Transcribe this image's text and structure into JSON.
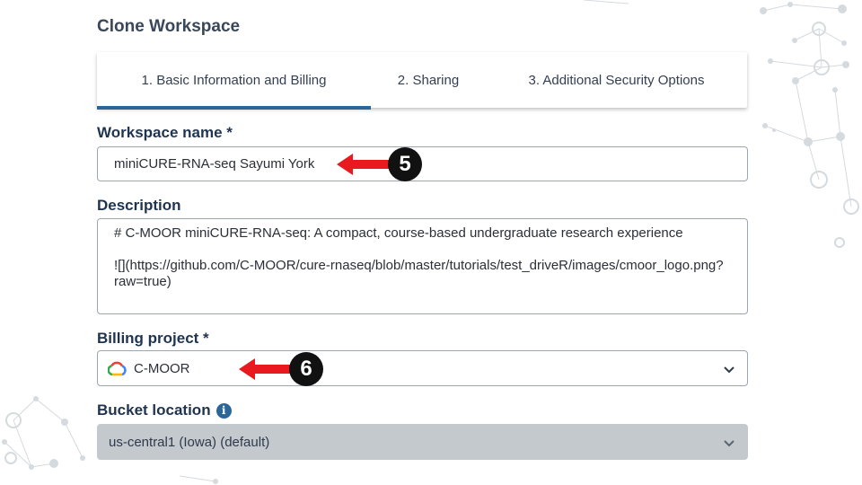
{
  "page": {
    "title": "Clone Workspace"
  },
  "tabs": [
    {
      "label": "1. Basic Information and Billing",
      "active": true
    },
    {
      "label": "2. Sharing",
      "active": false
    },
    {
      "label": "3. Additional Security Options",
      "active": false
    }
  ],
  "workspace_name": {
    "label": "Workspace name *",
    "value": "miniCURE-RNA-seq Sayumi York"
  },
  "description": {
    "label": "Description",
    "value": "# C-MOOR miniCURE-RNA-seq: A compact, course-based undergraduate research experience\n\n![](https://github.com/C-MOOR/cure-rnaseq/blob/master/tutorials/test_driveR/images/cmoor_logo.png?raw=true)"
  },
  "billing_project": {
    "label": "Billing project *",
    "value": "C-MOOR",
    "icon": "google-cloud-icon"
  },
  "bucket_location": {
    "label": "Bucket location",
    "value": "us-central1 (Iowa) (default)",
    "disabled": true,
    "info_icon": "info-icon"
  },
  "callouts": {
    "step_5": "5",
    "step_6": "6",
    "arrow_color": "#e8191f"
  },
  "colors": {
    "accent": "#2b6698",
    "label": "#1f3450",
    "disabled_bg": "#c4c9ce"
  }
}
